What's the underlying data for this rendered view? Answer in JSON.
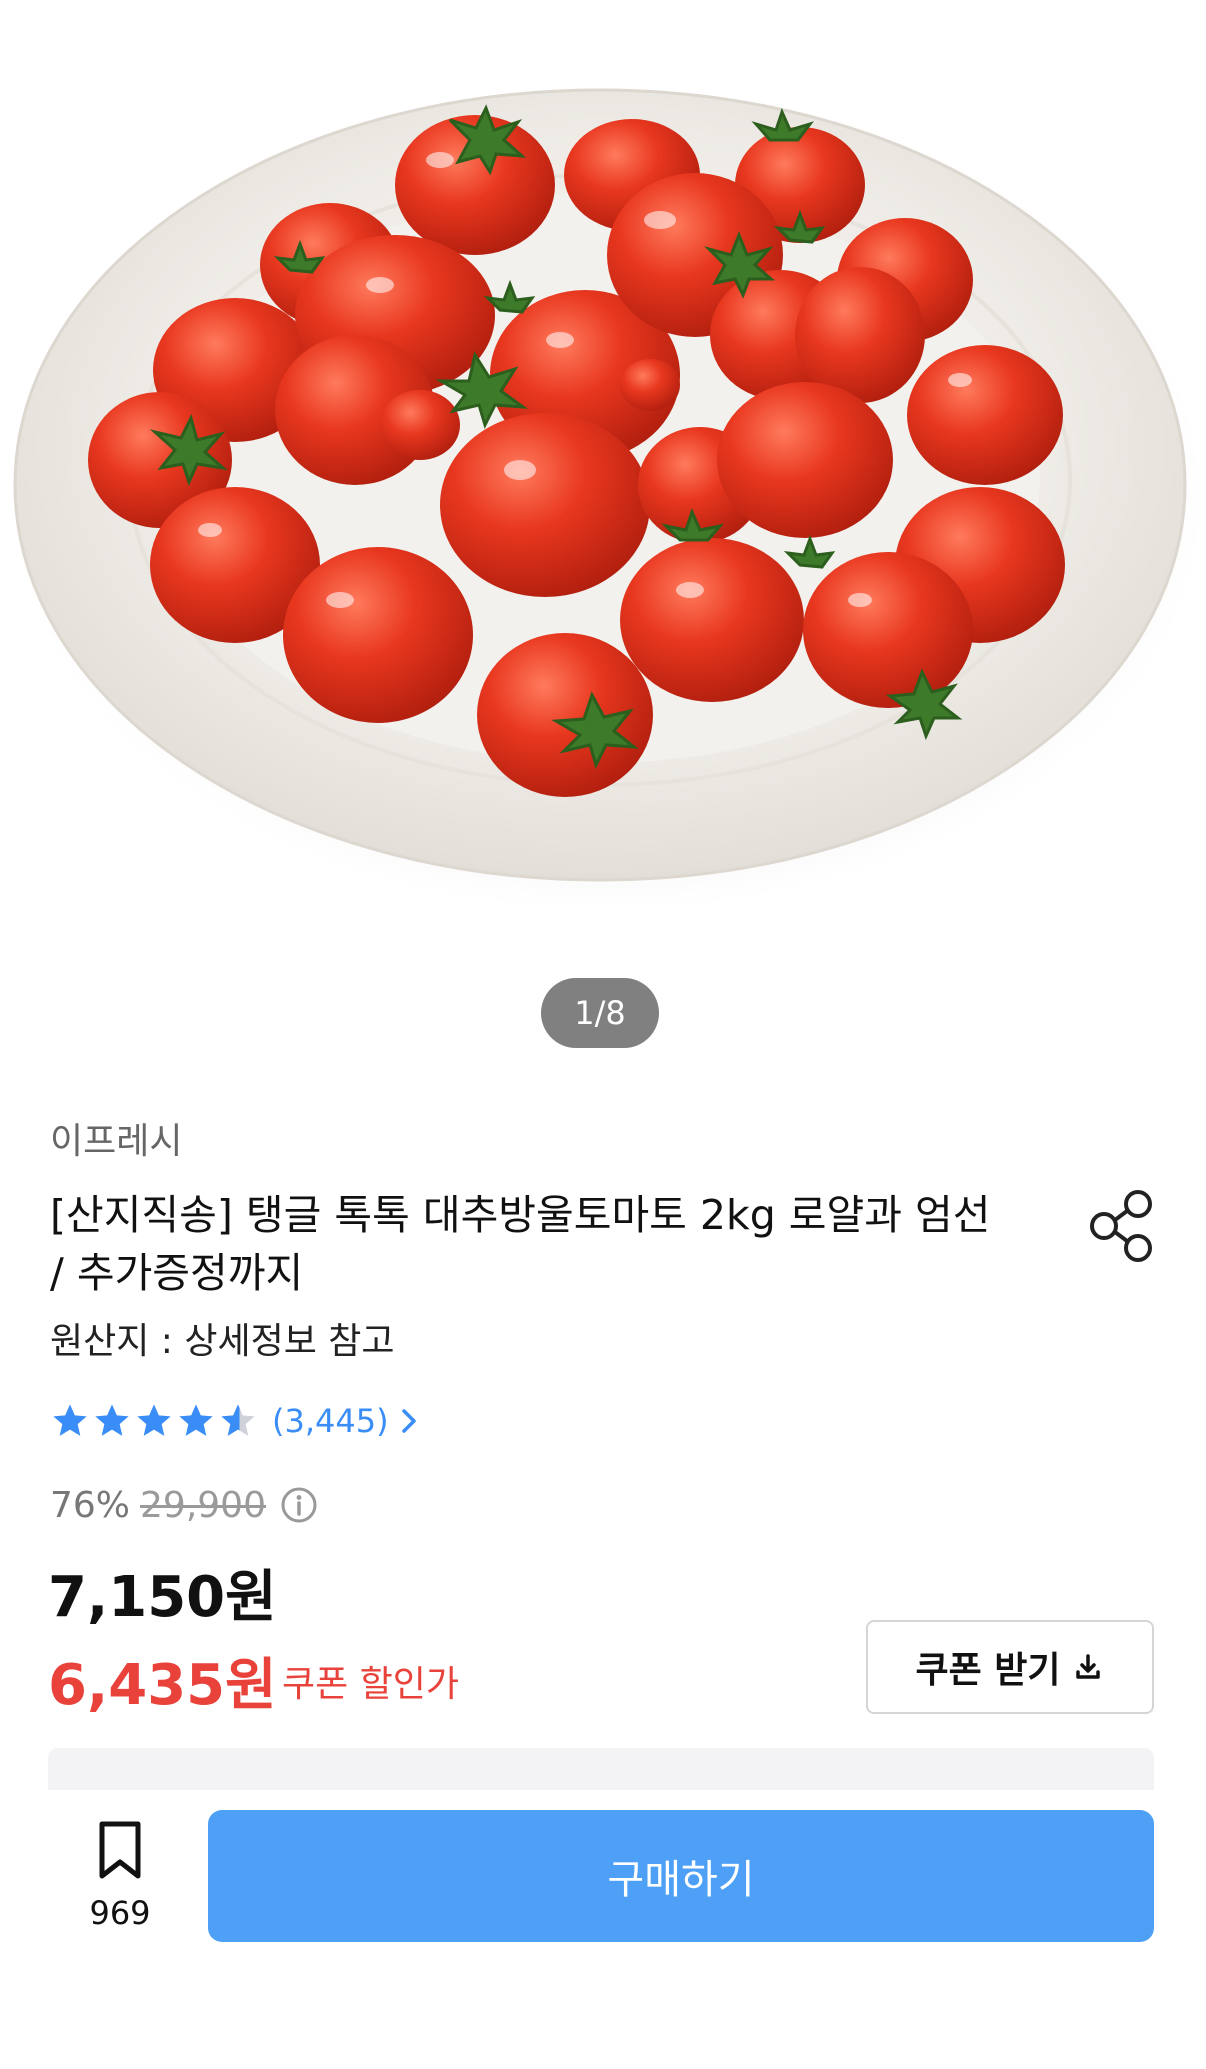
{
  "gallery": {
    "image_alt": "cherry tomatoes on a white plate",
    "pager": "1/8"
  },
  "product": {
    "seller": "이프레시",
    "title": "[산지직송] 탱글 톡톡 대추방울토마토 2kg 로얄과 엄선 / 추가증정까지",
    "origin": "원산지 : 상세정보 참고",
    "rating_count": "(3,445)",
    "rating_value": 4.5,
    "discount_rate": "76%",
    "original_price": "29,900",
    "price": "7,150원",
    "coupon_price": "6,435원",
    "coupon_label": "쿠폰 할인가",
    "coupon_button": "쿠폰 받기"
  },
  "bottom_bar": {
    "bookmark_count": "969",
    "buy_label": "구매하기"
  },
  "colors": {
    "accent_blue": "#4da0f6",
    "star_blue": "#3a8df6",
    "sale_red": "#e8423b"
  },
  "icons": [
    "share-icon",
    "star-icon",
    "chevron-right-icon",
    "info-icon",
    "download-icon",
    "bookmark-icon"
  ]
}
